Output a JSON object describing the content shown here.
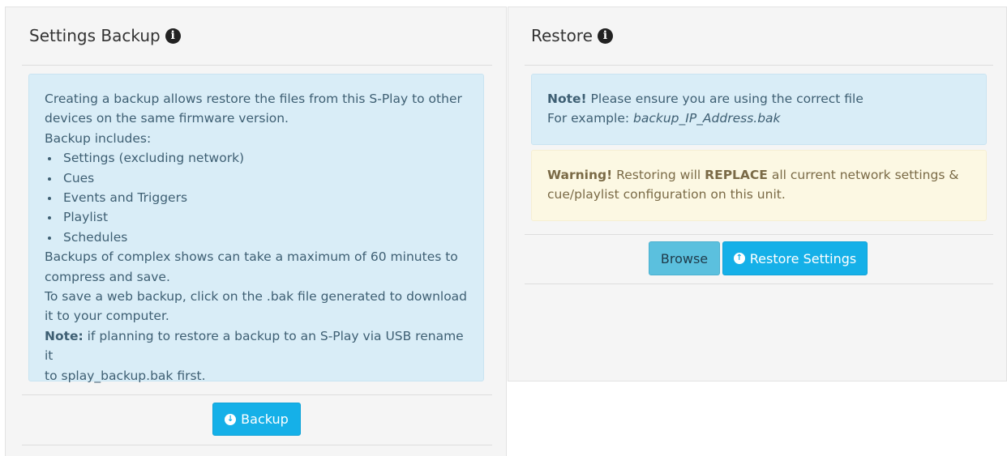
{
  "backup": {
    "title": "Settings Backup",
    "intro_line1": "Creating a backup allows restore the files from this S-Play to other",
    "intro_line2": "devices on the same firmware version.",
    "includes_label": "Backup includes:",
    "items": [
      "Settings (excluding network)",
      "Cues",
      "Events and Triggers",
      "Playlist",
      "Schedules"
    ],
    "compress_line1": "Backups of complex shows can take a maximum of 60 minutes to",
    "compress_line2": "compress and save.",
    "web_line1": "To save a web backup, click on the .bak file generated to download",
    "web_line2": "it to your computer.",
    "note_label": "Note:",
    "note_line1": " if planning to restore a backup to an S-Play via USB rename it",
    "note_line2": "to splay_backup.bak first.",
    "button_label": "Backup",
    "button_icon": "download-circle-icon"
  },
  "restore": {
    "title": "Restore",
    "note_label": "Note!",
    "note_text": " Please ensure you are using the correct file",
    "example_label": "For example: ",
    "example_value": "backup_IP_Address.bak",
    "warning_label": "Warning!",
    "warning_text1": " Restoring will ",
    "warning_emphasis": "REPLACE",
    "warning_text2": " all current network settings &",
    "warning_line2": "cue/playlist configuration on this unit.",
    "browse_label": "Browse",
    "restore_label": "Restore Settings",
    "restore_icon": "upload-circle-icon"
  },
  "colors": {
    "info_bg": "#d9edf7",
    "warning_bg": "#fcf8e3",
    "primary_button": "#15b0e8",
    "info_button": "#5bc0de"
  }
}
